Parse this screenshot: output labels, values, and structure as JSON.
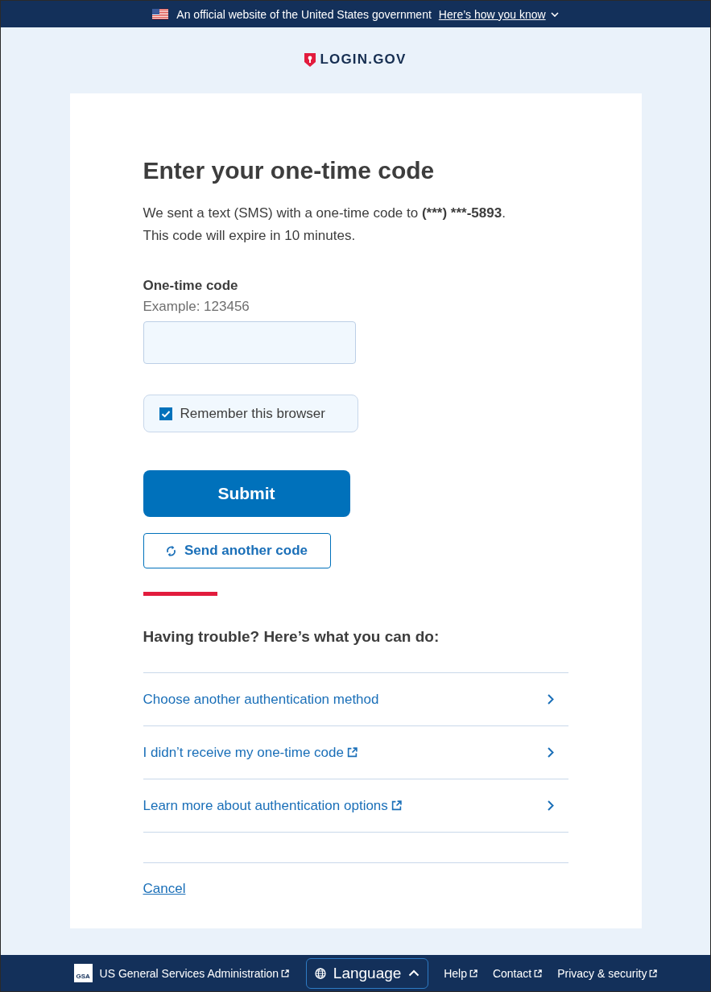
{
  "gov_banner": {
    "text": "An official website of the United States government",
    "link": "Here’s how you know"
  },
  "logo": {
    "text": "LOGIN.GOV"
  },
  "heading": "Enter your one-time code",
  "intro": {
    "before": "We sent a text (SMS) with a one-time code to ",
    "phone": "(***) ***-5893",
    "after": ".",
    "line2": "This code will expire in 10 minutes."
  },
  "code_field": {
    "label": "One-time code",
    "hint": "Example: 123456"
  },
  "remember": {
    "label": "Remember this browser",
    "checked": true
  },
  "submit": {
    "label": "Submit"
  },
  "resend": {
    "label": "Send another code"
  },
  "trouble": {
    "heading": "Having trouble? Here’s what you can do:",
    "options": [
      {
        "label": "Choose another authentication method",
        "external": false
      },
      {
        "label": "I didn’t receive my one-time code",
        "external": true
      },
      {
        "label": "Learn more about authentication options",
        "external": true
      }
    ]
  },
  "cancel": {
    "label": "Cancel"
  },
  "footer": {
    "logo_text": "GSA",
    "agency": {
      "label": "US General Services Administration",
      "external": true
    },
    "language": {
      "label": "Language"
    },
    "links": [
      {
        "label": "Help",
        "external": true
      },
      {
        "label": "Contact",
        "external": true
      },
      {
        "label": "Privacy & security",
        "external": true
      }
    ]
  }
}
